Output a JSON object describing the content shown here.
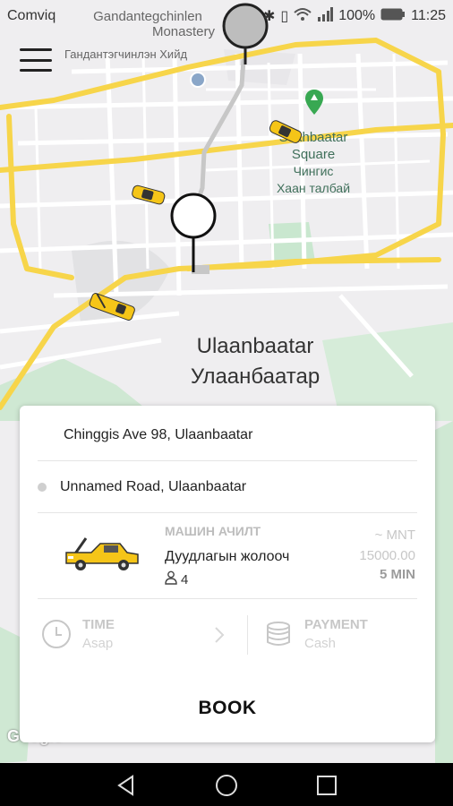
{
  "status_bar": {
    "carrier": "Comviq",
    "battery": "100%",
    "time": "11:25"
  },
  "map": {
    "labels": {
      "monastery_en_1": "Gandantegchinlen",
      "monastery_en_2": "Monastery",
      "monastery_mn": "Гандантэгчинлэн Хийд",
      "square_en_1": "Sukhbaatar",
      "square_en_2": "Square",
      "square_mn_1": "Чингис",
      "square_mn_2": "Хаан талбай",
      "city_en": "Ulaanbaatar",
      "city_mn": "Улаанбаатар",
      "google": "Google"
    }
  },
  "booking": {
    "from_address": "Chinggis Ave 98, Ulaanbaatar",
    "to_address": "Unnamed Road, Ulaanbaatar",
    "vehicle": {
      "category": "МАШИН АЧИЛТ",
      "name": "Дуудлагын жолооч",
      "seats": "4",
      "currency": "~ MNT",
      "price": "15000.00",
      "eta": "5 MIN"
    },
    "time": {
      "title": "TIME",
      "value": "Asap"
    },
    "payment": {
      "title": "PAYMENT",
      "value": "Cash"
    },
    "book_label": "BOOK"
  },
  "colors": {
    "road_major": "#f7d54a",
    "road_minor": "#ffffff",
    "park": "#c9e7cf",
    "accent": "#f5c518"
  }
}
